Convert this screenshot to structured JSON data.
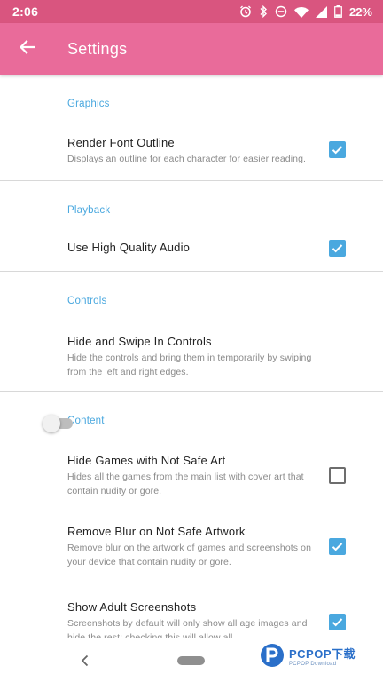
{
  "status_bar": {
    "time": "2:06",
    "battery": "22%",
    "icons": [
      "alarm-icon",
      "bluetooth-icon",
      "do-not-disturb-icon",
      "wifi-icon",
      "signal-icon",
      "battery-icon"
    ]
  },
  "app_bar": {
    "back_icon": "arrow-left-icon",
    "title": "Settings"
  },
  "sections": {
    "graphics": {
      "header": "Graphics",
      "render_font_outline": {
        "title": "Render Font Outline",
        "description": "Displays an outline for each character for easier reading.",
        "checked": true
      }
    },
    "playback": {
      "header": "Playback",
      "high_quality_audio": {
        "title": "Use High Quality Audio",
        "checked": true
      }
    },
    "controls": {
      "header": "Controls",
      "hide_swipe_controls": {
        "title": "Hide and Swipe In Controls",
        "description": "Hide the controls and bring them in temporarily by swiping from the left and right edges.",
        "enabled": false
      }
    },
    "content": {
      "header": "Content",
      "hide_not_safe_games": {
        "title": "Hide Games with Not Safe Art",
        "description": "Hides all the games from the main list with cover art that contain nudity or gore.",
        "checked": false
      },
      "remove_blur": {
        "title": "Remove Blur on Not Safe Artwork",
        "description": "Remove blur on the artwork of games and screenshots on your device that contain nudity or gore.",
        "checked": true
      },
      "show_adult_screenshots": {
        "title": "Show Adult Screenshots",
        "description": "Screenshots by default will only show all age images and hide the rest; checking this will allow all",
        "checked": true
      }
    }
  },
  "colors": {
    "status_bar": "#d9557f",
    "app_bar": "#e96b9a",
    "accent": "#4aa8df",
    "checkbox_checked": "#4aa8df"
  },
  "nav_bar": {
    "icons": [
      "nav-back-icon",
      "nav-home-pill"
    ]
  },
  "watermark": {
    "main": "PCPOP下载",
    "sub": "PCPOP Download"
  }
}
